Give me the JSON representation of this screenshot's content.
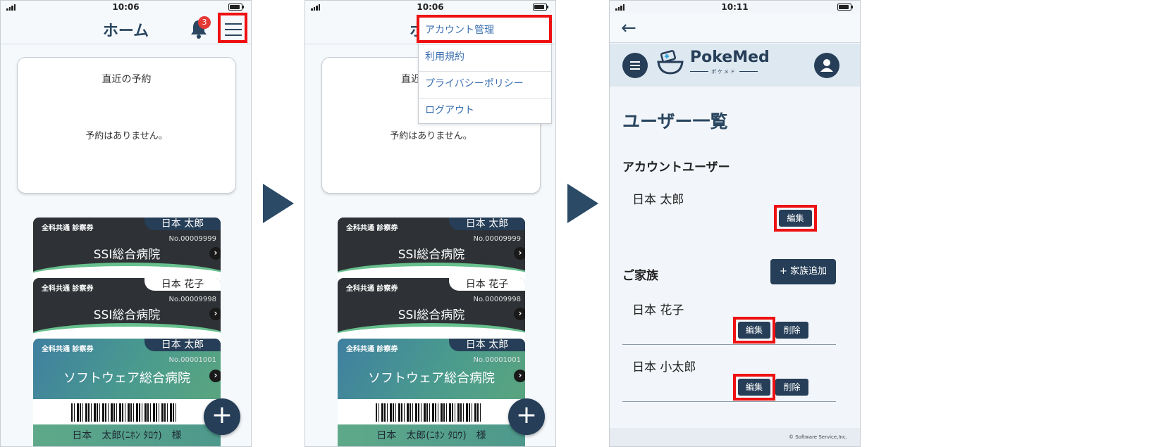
{
  "status": {
    "time1": "10:06",
    "time2": "10:06",
    "time3": "10:11"
  },
  "home": {
    "title": "ホーム",
    "notification_count": "3",
    "appointments": {
      "title": "直近の予約",
      "empty": "予約はありません。"
    },
    "cards": [
      {
        "type": "全科共通 診察券",
        "name": "日本 太郎",
        "number": "No.00009999",
        "hospital": "SSI総合病院"
      },
      {
        "type": "全科共通 診察券",
        "name": "日本 花子",
        "number": "No.00009998",
        "hospital": "SSI総合病院"
      },
      {
        "type": "全科共通 診察券",
        "name": "日本 太郎",
        "number": "No.00001001",
        "hospital": "ソフトウェア総合病院",
        "holder": "日本　太郎(ﾆﾎﾝ ﾀﾛｳ)　様"
      }
    ],
    "fab_label": "+"
  },
  "menu": {
    "items": [
      "アカウント管理",
      "利用規約",
      "プライバシーポリシー",
      "ログアウト"
    ],
    "partial_title": "ホ",
    "partial_appt_title": "直近"
  },
  "users": {
    "brand": "PokeMed",
    "brand_sub": "ポケメド",
    "page_title": "ユーザー一覧",
    "account_section": "アカウントユーザー",
    "account_user": "日本 太郎",
    "edit_label": "編集",
    "delete_label": "削除",
    "family_section": "ご家族",
    "add_family_label": "+ 家族追加",
    "family": [
      "日本 花子",
      "日本 小太郎"
    ],
    "footer": "© Software Service,Inc."
  },
  "colors": {
    "primary": "#263e57",
    "highlight": "#ee1111",
    "accent_green": "#67c08d",
    "link_blue": "#3a6fb0"
  }
}
